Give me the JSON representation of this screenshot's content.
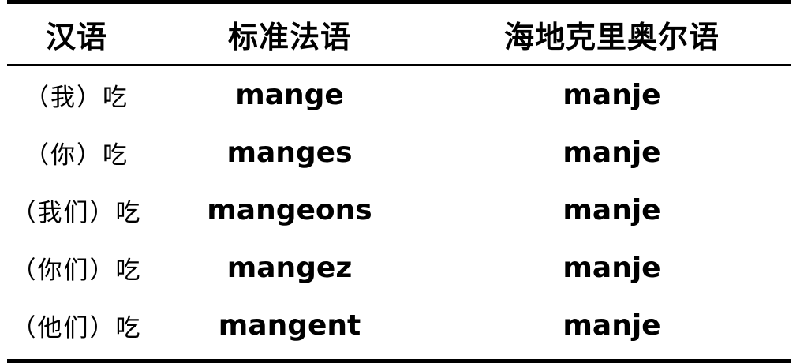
{
  "table": {
    "headers": [
      "汉语",
      "标准法语",
      "海地克里奥尔语"
    ],
    "rows": [
      [
        "（我）吃",
        "mange",
        "manje"
      ],
      [
        "（你）吃",
        "manges",
        "manje"
      ],
      [
        "（我们）吃",
        "mangeons",
        "manje"
      ],
      [
        "（你们）吃",
        "mangez",
        "manje"
      ],
      [
        "（他们）吃",
        "mangent",
        "manje"
      ]
    ]
  }
}
